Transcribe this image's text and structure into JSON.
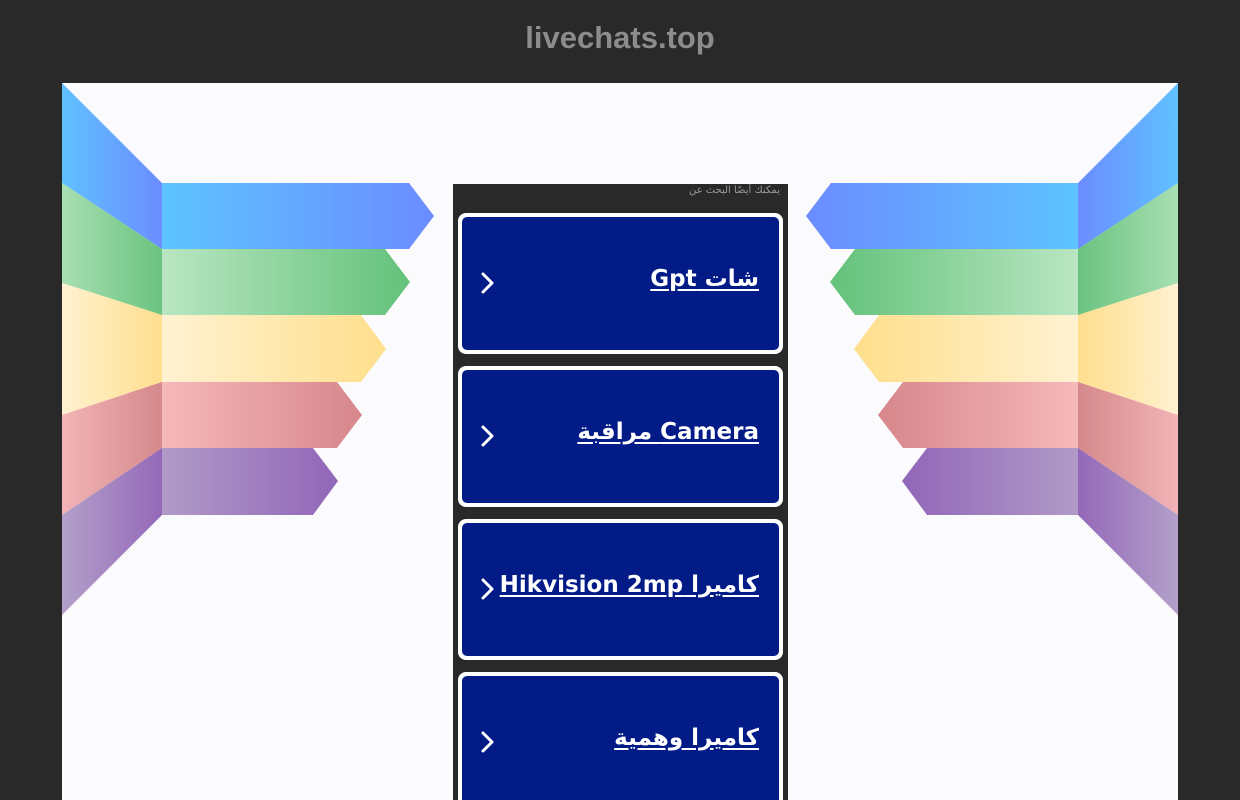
{
  "site": {
    "domain": "livechats.top"
  },
  "panel": {
    "heading": "يمكنك أيضًا البحث عن",
    "links": [
      {
        "label": "شات Gpt",
        "icon": "chevron-right-icon"
      },
      {
        "label": "Camera مراقبة",
        "icon": "chevron-right-icon"
      },
      {
        "label": "كاميرا Hikvision 2mp",
        "icon": "chevron-right-icon"
      },
      {
        "label": "كاميرا وهمية",
        "icon": "chevron-right-icon"
      }
    ]
  },
  "colors": {
    "page_bg": "#292929",
    "canvas_bg": "#fbfbfd",
    "card_bg": "#021b87",
    "card_border": "#ffffff",
    "title_text": "#8c8c8c",
    "wing_blue": "#5cbcff",
    "wing_green": "#74c985",
    "wing_yellow": "#ffe39a",
    "wing_red": "#e49fa2",
    "wing_purple": "#9b76bd"
  }
}
